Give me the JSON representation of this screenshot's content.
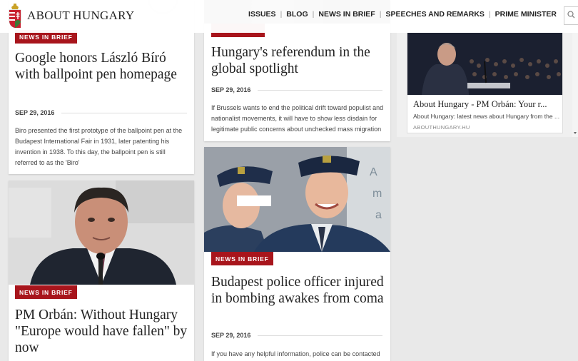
{
  "header": {
    "logo_text": "ABOUT HUNGARY",
    "nav": [
      "ISSUES",
      "BLOG",
      "NEWS IN BRIEF",
      "SPEECHES AND REMARKS",
      "PRIME MINISTER"
    ],
    "separator": "|"
  },
  "colors": {
    "badge": "#a8151c",
    "accent": "#a8151c"
  },
  "articles": [
    {
      "badge": "NEWS IN BRIEF",
      "title": "Google honors László Bíró with ballpoint pen homepage",
      "date": "SEP 29, 2016",
      "excerpt": "Biro presented the first prototype of the ballpoint pen at the Budapest International Fair in 1931, later patenting his invention in 1938. To this day, the ballpoint pen is still referred to as the 'Biro'"
    },
    {
      "badge": "",
      "title": "Hungary's referendum in the global spotlight",
      "date": "SEP 29, 2016",
      "excerpt": "If Brussels wants to end the political drift toward populist and nationalist movements, it will have to show less disdain for legitimate public concerns about unchecked mass migration"
    },
    {
      "badge": "NEWS IN BRIEF",
      "title": "PM Orbán: Without Hungary \"Europe would have fallen\" by now",
      "date": "",
      "excerpt": ""
    },
    {
      "badge": "NEWS IN BRIEF",
      "title": "Budapest police officer injured in bombing awakes from coma",
      "date": "SEP 29, 2016",
      "excerpt": "If you have any helpful information, police can be contacted"
    }
  ],
  "sidebar": {
    "embed_title": "About Hungary - PM Orbán: Your r...",
    "embed_desc": "About Hungary: latest news about Hungary from the ...",
    "embed_domain": "ABOUTHUNGARY.HU"
  }
}
